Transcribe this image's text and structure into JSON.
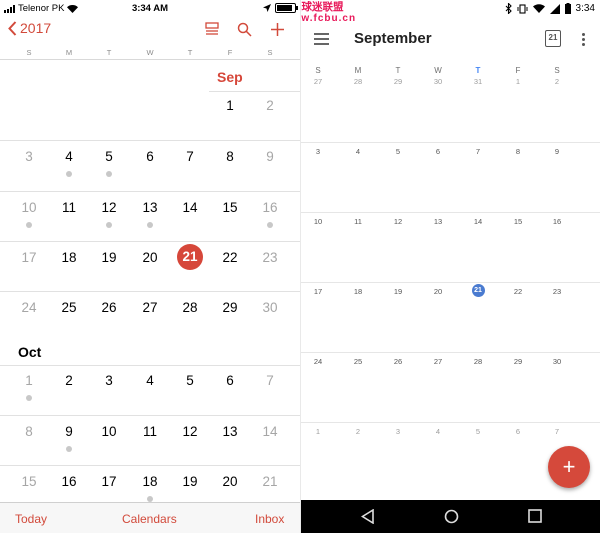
{
  "ios": {
    "status": {
      "carrier": "Telenor PK",
      "time": "3:34 AM"
    },
    "nav": {
      "back_label": "2017"
    },
    "weekdays": [
      "S",
      "M",
      "T",
      "W",
      "T",
      "F",
      "S"
    ],
    "months": [
      {
        "name": "Sep",
        "weeks": [
          [
            "",
            "",
            "",
            "",
            "",
            "1",
            "2"
          ],
          [
            "3",
            "4",
            "5",
            "6",
            "7",
            "8",
            "9"
          ],
          [
            "10",
            "11",
            "12",
            "13",
            "14",
            "15",
            "16"
          ],
          [
            "17",
            "18",
            "19",
            "20",
            "21",
            "22",
            "23"
          ],
          [
            "24",
            "25",
            "26",
            "27",
            "28",
            "29",
            "30"
          ]
        ]
      },
      {
        "name": "Oct",
        "weeks": [
          [
            "1",
            "2",
            "3",
            "4",
            "5",
            "6",
            "7"
          ],
          [
            "8",
            "9",
            "10",
            "11",
            "12",
            "13",
            "14"
          ],
          [
            "15",
            "16",
            "17",
            "18",
            "19",
            "20",
            "21"
          ]
        ]
      }
    ],
    "event_dots": [
      "Sep-4",
      "Sep-5",
      "Sep-10",
      "Sep-12",
      "Sep-13",
      "Sep-16",
      "Oct-1",
      "Oct-9",
      "Oct-18"
    ],
    "today": "21",
    "tabs": {
      "today": "Today",
      "calendars": "Calendars",
      "inbox": "Inbox"
    },
    "accent": "#d6473a"
  },
  "android": {
    "status": {
      "time": "3:34",
      "watermark_line1": "拜仁慕尼黑球迷联盟",
      "watermark_line2": "http://www.fcbu.cn"
    },
    "title": "September",
    "calendar_icon_day": "21",
    "weekdays": [
      "S",
      "M",
      "T",
      "W",
      "T",
      "F",
      "S"
    ],
    "weeks": [
      [
        "27",
        "28",
        "29",
        "30",
        "31",
        "1",
        "2"
      ],
      [
        "3",
        "4",
        "5",
        "6",
        "7",
        "8",
        "9"
      ],
      [
        "10",
        "11",
        "12",
        "13",
        "14",
        "15",
        "16"
      ],
      [
        "17",
        "18",
        "19",
        "20",
        "21",
        "22",
        "23"
      ],
      [
        "24",
        "25",
        "26",
        "27",
        "28",
        "29",
        "30"
      ],
      [
        "1",
        "2",
        "3",
        "4",
        "5",
        "6",
        "7"
      ]
    ],
    "today": "21",
    "fab_label": "+",
    "accent": "#4a7bd0"
  }
}
